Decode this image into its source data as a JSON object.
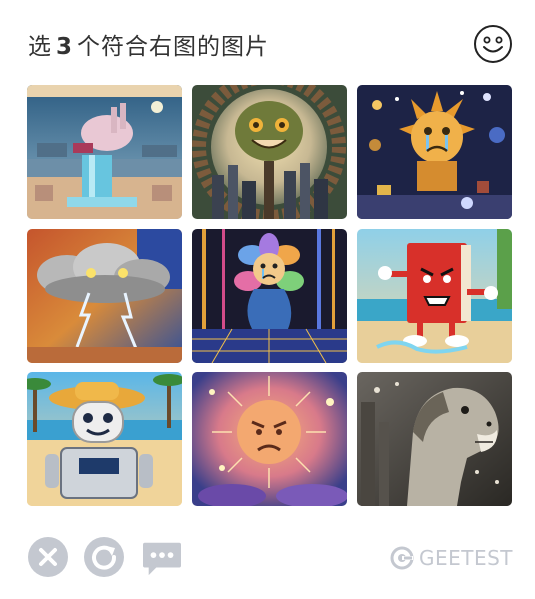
{
  "header": {
    "title_prefix": "选",
    "title_count": "3",
    "title_suffix": "个符合右图的图片",
    "reference_icon": "smiley-face-icon"
  },
  "grid": {
    "tiles": [
      {
        "id": 1,
        "depicts": "pixel-art bird on waterfall"
      },
      {
        "id": 2,
        "depicts": "smiling face tree over city"
      },
      {
        "id": 3,
        "depicts": "crying sun in space"
      },
      {
        "id": 4,
        "depicts": "storm cloud with lightning"
      },
      {
        "id": 5,
        "depicts": "crying flower person"
      },
      {
        "id": 6,
        "depicts": "angry red book running"
      },
      {
        "id": 7,
        "depicts": "smiling robot on beach"
      },
      {
        "id": 8,
        "depicts": "angry sun"
      },
      {
        "id": 9,
        "depicts": "laughing horse"
      }
    ]
  },
  "footer": {
    "close_icon": "close-icon",
    "refresh_icon": "refresh-icon",
    "feedback_icon": "feedback-icon",
    "brand": "GEETEST"
  },
  "colors": {
    "title": "#333333",
    "icon_gray": "#c4c8d0",
    "brand": "#c4c8d0"
  }
}
